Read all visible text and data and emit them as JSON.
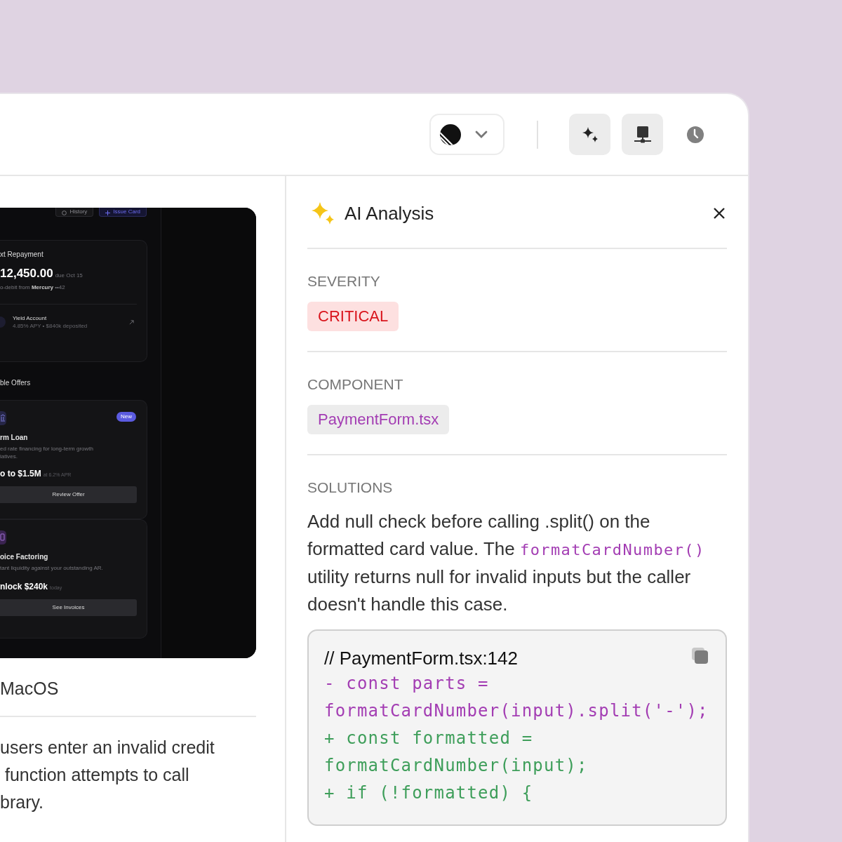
{
  "toolbar": {
    "buttons": [
      {
        "kind": "sparkle",
        "selected": true
      },
      {
        "kind": "network",
        "selected": true
      },
      {
        "kind": "clock",
        "selected": false
      }
    ]
  },
  "preview": {
    "header_buttons": [
      {
        "kind": "history",
        "label": "History"
      },
      {
        "kind": "add",
        "label": "Issue Card"
      }
    ],
    "repayment": {
      "title": "xt Repayment",
      "amount": "12,450.00",
      "due": "due Oct 15",
      "autodebit": "o-debit from **Mercury** ••42",
      "account_name": "Yield Account",
      "account_detail": "4.85% APY • $840k deposited"
    },
    "offers_title": "ble Offers",
    "offers": [
      {
        "kind": "bank",
        "badge": "New",
        "title": "rm Loan",
        "description_lines": [
          "ed rate financing for long-term growth",
          "iatives."
        ],
        "amount": "o to $1.5M",
        "amount_note": "at 6.2% APR",
        "button": "Review Offer"
      },
      {
        "kind": "invoice",
        "title": "oice Factoring",
        "description_lines": [
          "tant liquidity against your outstanding AR."
        ],
        "amount": "nlock $240k",
        "amount_note": "today",
        "button": "See Invoices"
      }
    ]
  },
  "caption": "MacOS",
  "description_lines": [
    "users enter an invalid credit",
    " function attempts to call",
    "brary."
  ],
  "analysis": {
    "title": "AI Analysis",
    "severity_label": "SEVERITY",
    "severity": "CRITICAL",
    "component_label": "COMPONENT",
    "component": "PaymentForm.tsx",
    "solutions_label": "SOLUTIONS",
    "solution": {
      "before": "Add null check before calling .split() on the formatted card value. The",
      "code": "formatCardNumber()",
      "after": "utility returns null for invalid inputs but the caller doesn't handle this case."
    },
    "code_comment": "// PaymentForm.tsx:142",
    "code_lines": [
      {
        "kind": "removed",
        "text": "- const parts ="
      },
      {
        "kind": "removed",
        "text": "formatCardNumber(input).split('-');"
      },
      {
        "kind": "added",
        "text": "+ const formatted ="
      },
      {
        "kind": "added",
        "text": "formatCardNumber(input);"
      },
      {
        "kind": "added",
        "text": "+ if (!formatted) {"
      }
    ]
  }
}
